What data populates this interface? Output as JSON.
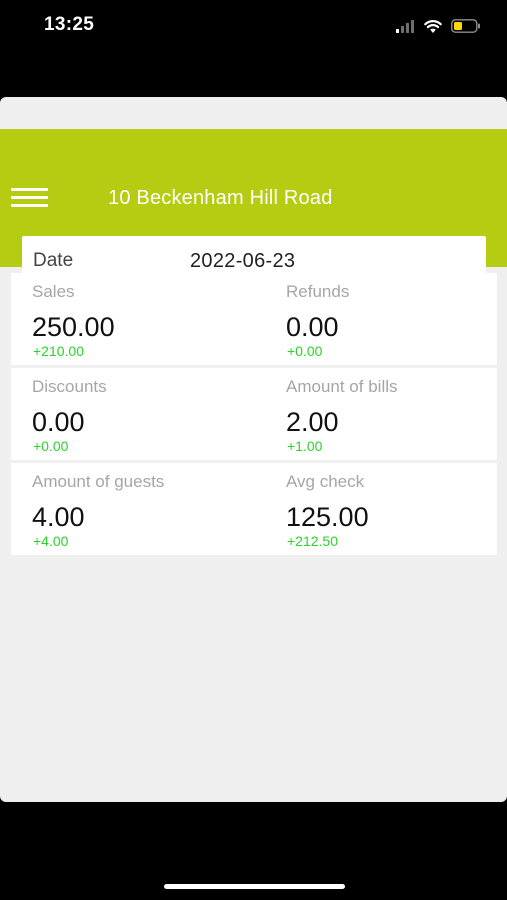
{
  "status_bar": {
    "time": "13:25"
  },
  "header": {
    "title": "10 Beckenham Hill Road",
    "accent_color": "#b5cc12"
  },
  "date_field": {
    "label": "Date",
    "value": "2022-06-23"
  },
  "stats": [
    {
      "left": {
        "label": "Sales",
        "value": "250.00",
        "delta": "+210.00"
      },
      "right": {
        "label": "Refunds",
        "value": "0.00",
        "delta": "+0.00"
      }
    },
    {
      "left": {
        "label": "Discounts",
        "value": "0.00",
        "delta": "+0.00"
      },
      "right": {
        "label": "Amount of bills",
        "value": "2.00",
        "delta": "+1.00"
      }
    },
    {
      "left": {
        "label": "Amount of guests",
        "value": "4.00",
        "delta": "+4.00"
      },
      "right": {
        "label": "Avg check",
        "value": "125.00",
        "delta": "+212.50"
      }
    }
  ],
  "icons": {
    "menu": "hamburger-menu-icon",
    "signal": "cellular-signal-icon",
    "wifi": "wifi-icon",
    "battery": "battery-icon"
  },
  "colors": {
    "positive_delta": "#2bd42b",
    "battery_fill": "#ffd60a"
  }
}
